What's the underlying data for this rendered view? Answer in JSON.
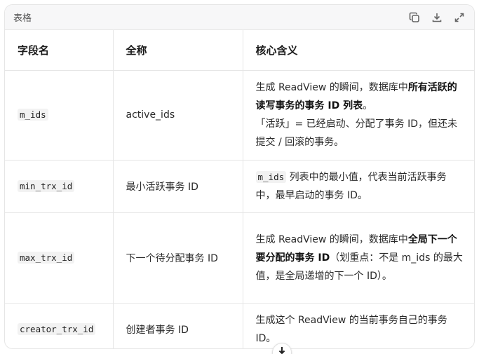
{
  "toolbar": {
    "title": "表格",
    "icons": [
      "copy-icon",
      "download-icon",
      "expand-icon"
    ]
  },
  "table": {
    "headers": [
      "字段名",
      "全称",
      "核心含义"
    ],
    "rows": [
      {
        "field": "m_ids",
        "full_name": "active_ids",
        "meaning_pre": "生成 ReadView 的瞬间，数据库中",
        "meaning_bold": "所有活跃的读写事务的事务 ID 列表",
        "meaning_post": "。",
        "meaning_note": "「活跃」= 已经启动、分配了事务 ID，但还未提交 / 回滚的事务。"
      },
      {
        "field": "min_trx_id",
        "full_name": "最小活跃事务 ID",
        "meaning_code": "m_ids",
        "meaning_post": " 列表中的最小值，代表当前活跃事务中，最早启动的事务 ID。"
      },
      {
        "field": "max_trx_id",
        "full_name": "下一个待分配事务 ID",
        "meaning_pre": "生成 ReadView 的瞬间，数据库中",
        "meaning_bold": "全局下一个要分配的事务 ID",
        "meaning_post": "（划重点：不是 m_ids 的最大值，是全局递增的下一个 ID）。"
      },
      {
        "field": "creator_trx_id",
        "full_name": "创建者事务 ID",
        "meaning_post": "生成这个 ReadView 的当前事务自己的事务 ID。"
      }
    ]
  },
  "scroll_button": {
    "icon": "arrow-down-icon"
  }
}
